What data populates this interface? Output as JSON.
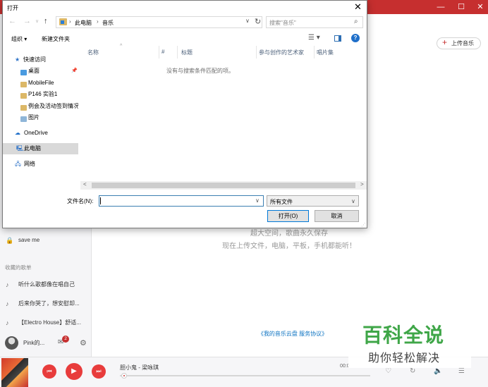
{
  "app": {
    "upload_button": "上传音乐",
    "sidebar_song": "save me",
    "collected_section": "收藏的歌单",
    "playlists": [
      "听什么歌都像在唱自己",
      "后来你哭了，想安慰却...",
      "【Electro House】舒适..."
    ],
    "username": "Pink的...",
    "message_count": "2",
    "cloud_line1": "超大空间，歌曲永久保存",
    "cloud_line2": "现在上传文件，电脑，平板，手机都能听！",
    "cloud_link": "《我的音乐云盘 服务协议》"
  },
  "watermark": {
    "title": "百科全说",
    "subtitle": "助你轻松解决"
  },
  "player": {
    "track": "胆小鬼 - 梁咏琪",
    "time": "00:0",
    "progress_fraction": 0.01
  },
  "dialog": {
    "title": "打开",
    "address": {
      "crumbs": [
        "此电脑",
        "音乐"
      ]
    },
    "search_placeholder": "搜索\"音乐\"",
    "toolbar": {
      "organize": "组织 ▾",
      "new_folder": "新建文件夹"
    },
    "nav": {
      "quick_access": "快速访问",
      "items": [
        "桌面",
        "MobileFile",
        "P146 实验1",
        "例会及活动签到情况",
        "图片"
      ],
      "onedrive": "OneDrive",
      "this_pc": "此电脑",
      "network": "网络"
    },
    "columns": [
      "名称",
      "#",
      "标题",
      "参与创作的艺术家",
      "唱片集"
    ],
    "empty_message": "没有与搜索条件匹配的项。",
    "filename_label": "文件名(N):",
    "filename_value": "",
    "filetype": "所有文件",
    "open_button": "打开(O)",
    "cancel_button": "取消"
  },
  "colors": {
    "brand_red": "#c62f2f",
    "watermark_green": "#3fa648",
    "dialog_accent": "#0078d7"
  }
}
